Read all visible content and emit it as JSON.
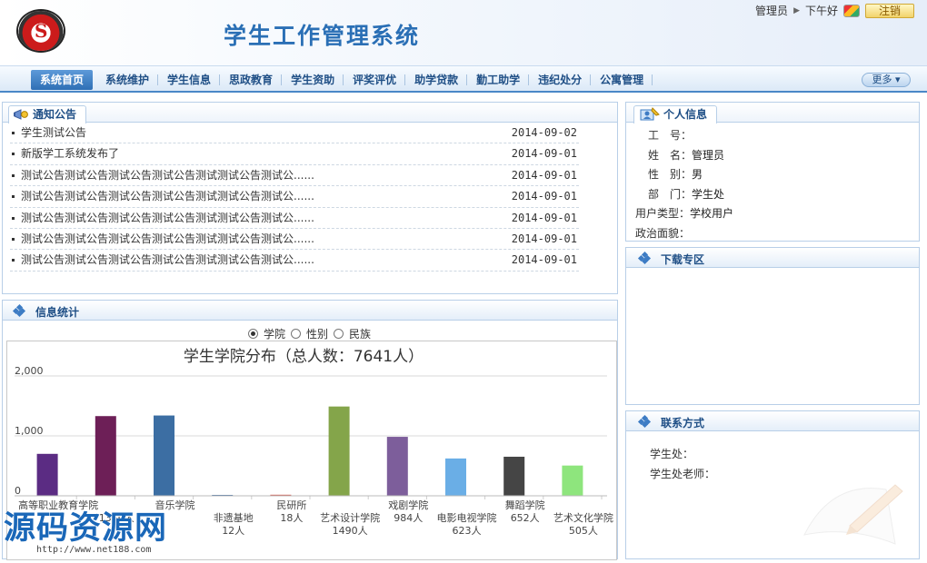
{
  "header": {
    "logo_char": "S",
    "title": "学生工作管理系统",
    "user": "管理员",
    "greeting": "下午好",
    "logout_label": "注销"
  },
  "nav": {
    "items": [
      "系统首页",
      "系统维护",
      "学生信息",
      "思政教育",
      "学生资助",
      "评奖评优",
      "助学贷款",
      "勤工助学",
      "违纪处分",
      "公寓管理"
    ],
    "more_label": "更多"
  },
  "notices": {
    "title": "通知公告",
    "items": [
      {
        "text": "学生测试公告",
        "date": "2014-09-02"
      },
      {
        "text": "新版学工系统发布了",
        "date": "2014-09-01"
      },
      {
        "text": "测试公告测试公告测试公告测试公告测试测试公告测试公......",
        "date": "2014-09-01"
      },
      {
        "text": "测试公告测试公告测试公告测试公告测试测试公告测试公......",
        "date": "2014-09-01"
      },
      {
        "text": "测试公告测试公告测试公告测试公告测试测试公告测试公......",
        "date": "2014-09-01"
      },
      {
        "text": "测试公告测试公告测试公告测试公告测试测试公告测试公......",
        "date": "2014-09-01"
      },
      {
        "text": "测试公告测试公告测试公告测试公告测试测试公告测试公......",
        "date": "2014-09-01"
      }
    ]
  },
  "stats": {
    "title": "信息统计",
    "radio_options": [
      "学院",
      "性别",
      "民族"
    ],
    "selected": "学院"
  },
  "chart_data": {
    "type": "bar",
    "title": "学生学院分布（总人数：7641人）",
    "ylim": [
      0,
      2000
    ],
    "yticks": [
      "2,000",
      "1,000",
      "0"
    ],
    "categories": [
      "高等职业教育学院",
      "音乐学院",
      "音乐学院",
      "非遗基地",
      "民研所",
      "艺术设计学院",
      "戏剧学院",
      "电影电视学院",
      "舞蹈学院",
      "艺术文化学院"
    ],
    "visible_labels": [
      "高等职业教育学院",
      "",
      "音乐学院",
      "非遗基地",
      "民研所",
      "艺术设计学院",
      "戏剧学院",
      "电影电视学院",
      "舞蹈学院",
      "艺术文化学院"
    ],
    "value_labels": [
      "",
      "1330人",
      "",
      "12人",
      "18人",
      "1490人",
      "984人",
      "623人",
      "652人",
      "505人"
    ],
    "values": [
      700,
      1330,
      1340,
      12,
      18,
      1490,
      984,
      623,
      652,
      505
    ],
    "colors": [
      "#5b2c83",
      "#6d1f57",
      "#3c6ea3",
      "#3c6ea3",
      "#d6584c",
      "#84a54a",
      "#7d5e9b",
      "#6aaee6",
      "#454545",
      "#8ee57d"
    ]
  },
  "profile": {
    "title": "个人信息",
    "rows": [
      {
        "k": "工　号：",
        "v": ""
      },
      {
        "k": "姓　名：",
        "v": "管理员"
      },
      {
        "k": "性　别：",
        "v": "男"
      },
      {
        "k": "部　门：",
        "v": "学生处"
      },
      {
        "k": "用户类型：",
        "v": "学校用户"
      },
      {
        "k": "政治面貌：",
        "v": ""
      }
    ]
  },
  "downloads": {
    "title": "下载专区"
  },
  "contact": {
    "title": "联系方式",
    "office_label": "学生处：",
    "teacher_label": "学生处老师："
  },
  "watermark": {
    "text": "源码资源网",
    "url": "http://www.net188.com"
  }
}
